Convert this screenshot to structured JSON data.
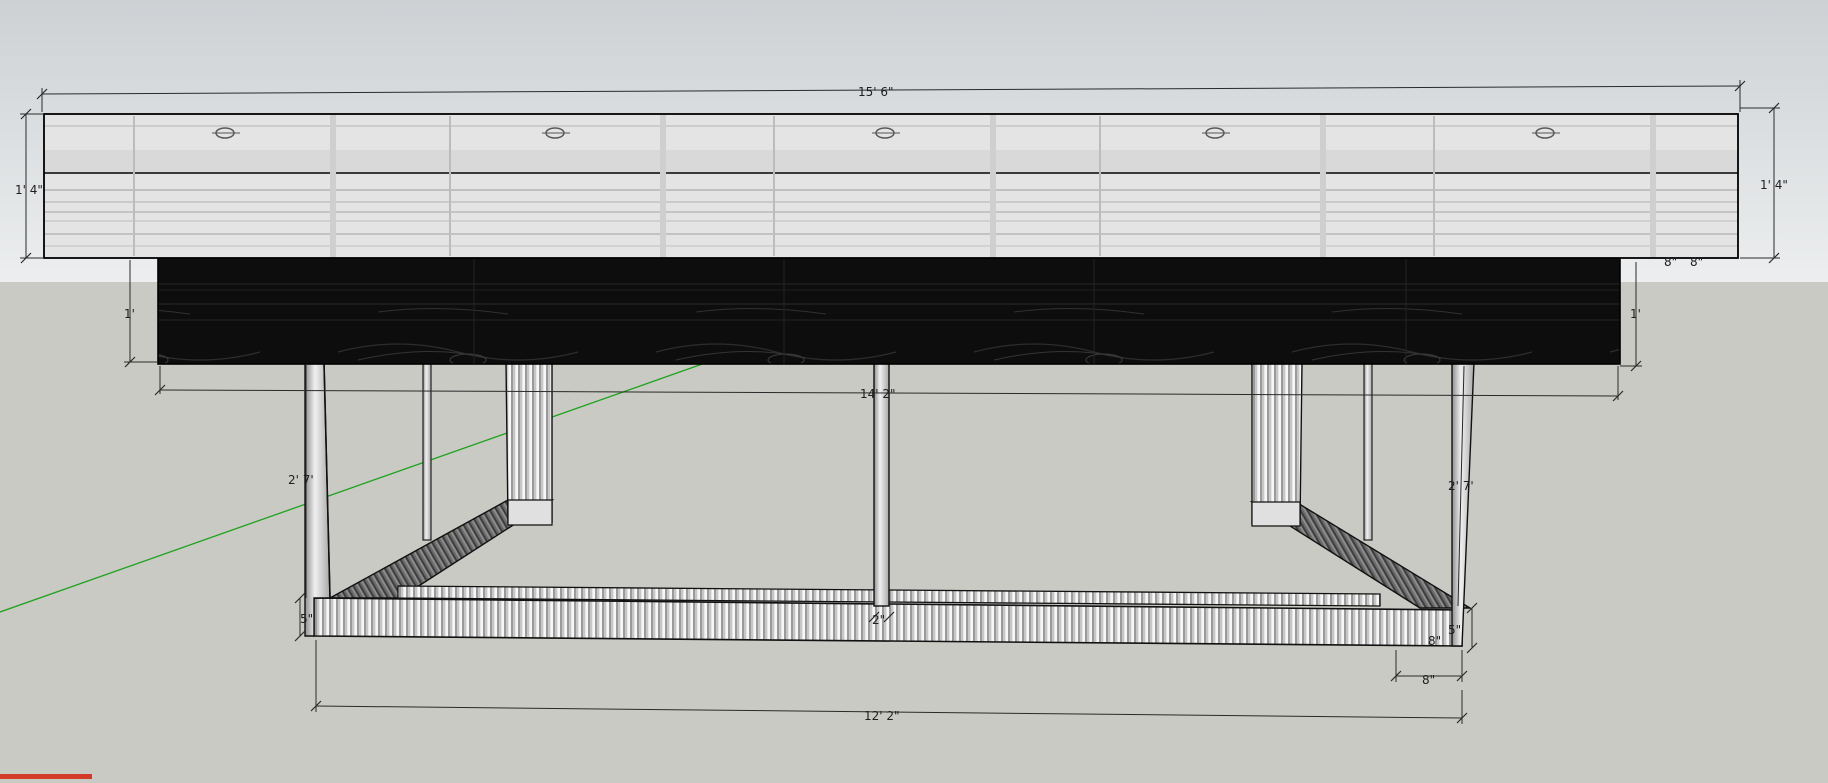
{
  "scene": {
    "colors": {
      "sky_top": "#cfd3d6",
      "sky_bottom": "#e8eaec",
      "ground": "#c9cac3",
      "axis_green": "#1ea21e",
      "axis_red": "#d33a2a",
      "cap_wood": "#e6e6e6",
      "box_wood": "#111111",
      "steel": "#d8d8d8"
    },
    "dimensions": {
      "top_length": "15' 6\"",
      "top_height_left": "1' 4\"",
      "top_height_right": "1' 4\"",
      "box_height_left": "1'",
      "box_height_right": "1'",
      "box_length": "14' 2\"",
      "leg_height_left": "2' 7'",
      "leg_height_right": "2' 7'",
      "base_height_left": "5\"",
      "base_height_right": "5\"",
      "center_post_width": "2\"",
      "base_depth": "8\"",
      "right_leg_depth": "8\"",
      "base_length": "12' 2\"",
      "corner_mark_1": "8\"",
      "corner_mark_2": "8\""
    }
  }
}
